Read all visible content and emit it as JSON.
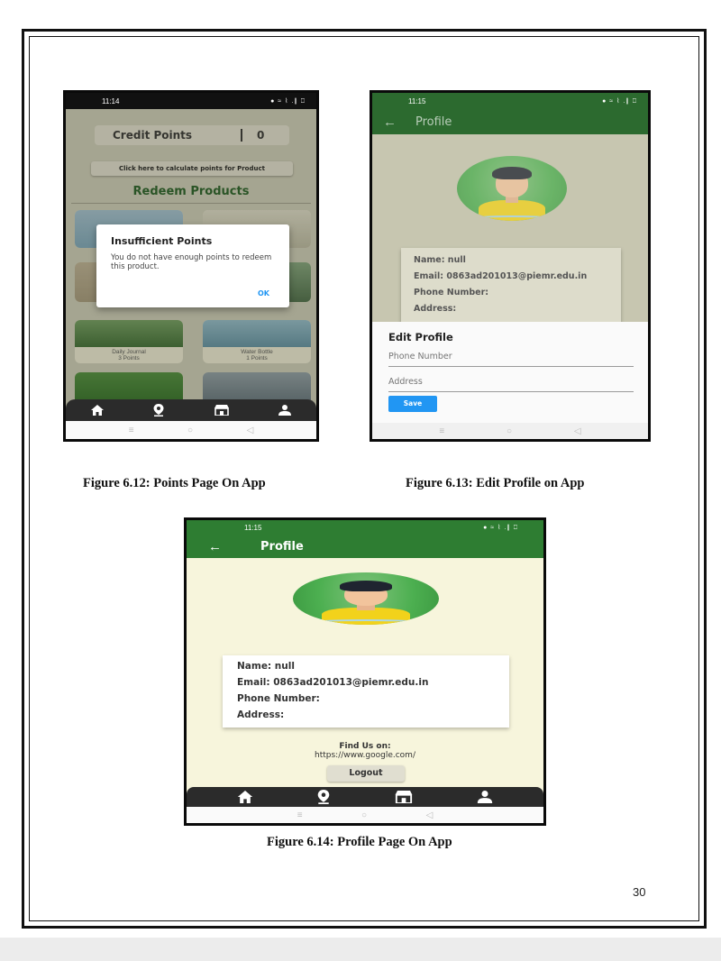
{
  "figure1": {
    "caption": "Figure 6.12: Points Page On App",
    "time": "11:14",
    "status_icons": "● ≈ ⌇ .∥ ⎕",
    "credit_label": "Credit Points",
    "credit_value": "0",
    "calc_button": "Click here to calculate points for Product",
    "section_title": "Redeem Products",
    "products": [
      {
        "name": "Daily Journal",
        "points": "3 Points"
      },
      {
        "name": "Water Bottle",
        "points": "1 Points"
      }
    ],
    "dialog": {
      "title": "Insufficient Points",
      "message": "You do not have enough points to redeem this product.",
      "ok": "OK"
    }
  },
  "figure2": {
    "caption": "Figure 6.13: Edit Profile on App",
    "time": "11:15",
    "status_icons": "● ≈ ⌇ .∥ ⎕",
    "title": "Profile",
    "info": {
      "name": "Name: null",
      "email": "Email: 0863ad201013@piemr.edu.in",
      "phone": "Phone Number:",
      "address": "Address:"
    },
    "sheet": {
      "title": "Edit Profile",
      "phone_placeholder": "Phone Number",
      "address_placeholder": "Address",
      "save": "Save"
    }
  },
  "figure3": {
    "caption": "Figure 6.14: Profile Page On App",
    "time": "11:15",
    "status_icons": "● ≈ ⌇ .∥ ⎕",
    "title": "Profile",
    "info": {
      "name": "Name: null",
      "email": "Email: 0863ad201013@piemr.edu.in",
      "phone": "Phone Number:",
      "address": "Address:"
    },
    "find_us": "Find Us on:",
    "find_url": "https://www.google.com/",
    "logout": "Logout"
  },
  "nav_icons": [
    "home-icon",
    "location-icon",
    "shop-icon",
    "person-icon"
  ],
  "page_number": "30",
  "colors": {
    "appbar": "#2e7d32",
    "nav": "#2b2b2b",
    "screen_bg": "#f5f5dc",
    "accent": "#2196f3"
  }
}
